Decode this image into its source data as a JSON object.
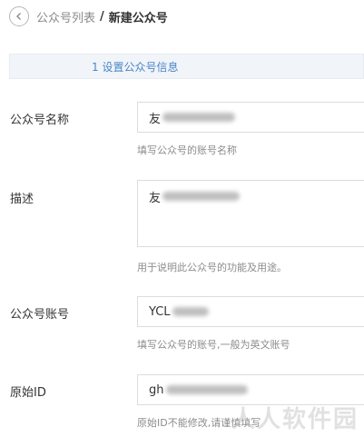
{
  "breadcrumb": {
    "back_icon": "chevron-left-icon",
    "parent": "公众号列表",
    "separator": "/",
    "current": "新建公众号"
  },
  "step": {
    "label": "1 设置公众号信息"
  },
  "form": {
    "name": {
      "label": "公众号名称",
      "value_prefix": "友",
      "hint": "填写公众号的账号名称"
    },
    "description": {
      "label": "描述",
      "value_prefix": "友",
      "hint": "用于说明此公众号的功能及用途。"
    },
    "account": {
      "label": "公众号账号",
      "value_prefix": "YCL",
      "hint": "填写公众号的账号,一般为英文账号"
    },
    "original_id": {
      "label": "原始ID",
      "value_prefix": "gh",
      "hint": "原始ID不能修改,请谨慎填写"
    }
  },
  "watermark": "人人软件园"
}
